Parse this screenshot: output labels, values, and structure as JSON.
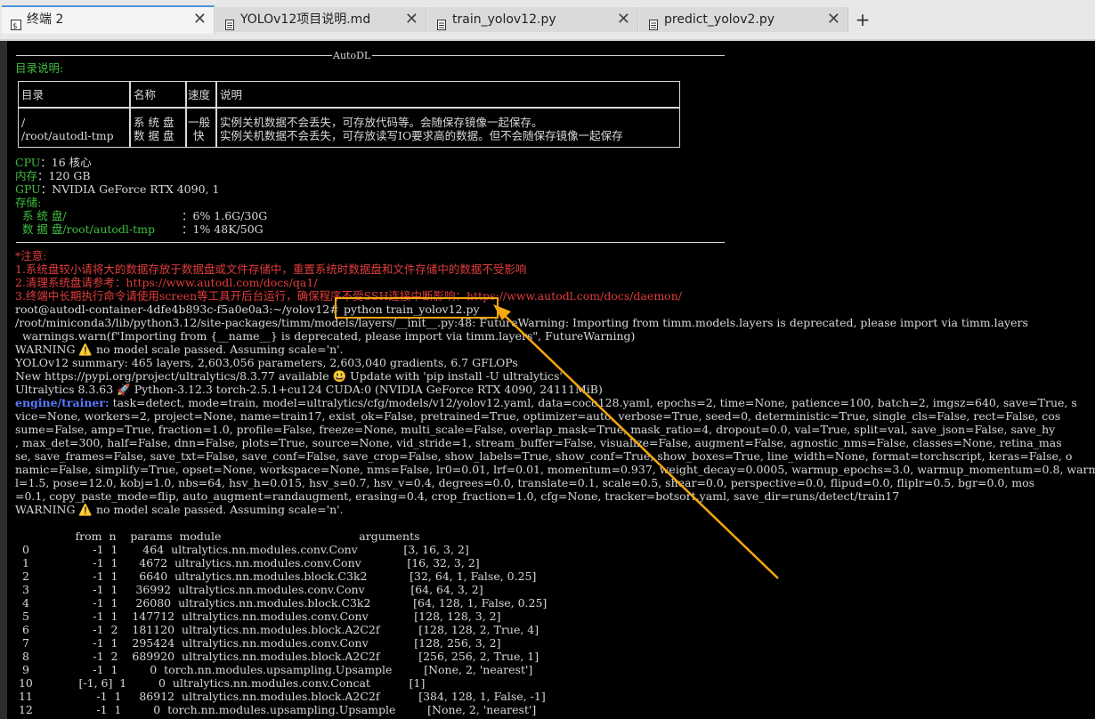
{
  "tabs": [
    {
      "label": "终端 2",
      "icon": "terminal-icon",
      "active": true
    },
    {
      "label": "YOLOv12项目说明.md",
      "icon": "document-icon",
      "active": false
    },
    {
      "label": "train_yolov12.py",
      "icon": "document-icon",
      "active": false
    },
    {
      "label": "predict_yolov2.py",
      "icon": "document-icon",
      "active": false
    }
  ],
  "close_glyph": "✕",
  "new_tab_glyph": "+",
  "terminal": {
    "banner": "AutoDL",
    "dir_title": "目录说明:",
    "table": {
      "headers": [
        "目录",
        "名称",
        "速度",
        "说明"
      ],
      "row": {
        "dirs": [
          "/",
          "/root/autodl-tmp"
        ],
        "names": [
          "系 统 盘",
          "数 据 盘"
        ],
        "speeds": [
          "一般",
          "快"
        ],
        "descs": [
          "实例关机数据不会丢失，可存放代码等。会随保存镜像一起保存。",
          "实例关机数据不会丢失，可存放读写IO要求高的数据。但不会随保存镜像一起保存"
        ]
      }
    },
    "cpu_label": "CPU",
    "cpu_value": "：16 核心",
    "mem_label": "内存",
    "mem_value": "：120 GB",
    "gpu_label": "GPU",
    "gpu_value": "：NVIDIA GeForce RTX 4090, 1",
    "storage_label": "存储:",
    "sys_disk_label": "  系 统 盘/",
    "sys_disk_value": "：6% 1.6G/30G",
    "data_disk_label": "  数 据 盘/root/autodl-tmp",
    "data_disk_value": "：1% 48K/50G",
    "note_title": "*注意:",
    "note1": "1.系统盘较小请将大的数据存放于数据盘或文件存储中，重置系统时数据盘和文件存储中的数据不受影响",
    "note2": "2.清理系统盘请参考：https://www.autodl.com/docs/qa1/",
    "note3": "3.终端中长期执行命令请使用screen等工具开后台运行，确保程序不受SSH连接中断影响：https://www.autodl.com/docs/daemon/",
    "prompt": "root@autodl-container-4dfe4b893c-f5a0e0a3:~/yolov12# ",
    "command": "python train_yolov12.py",
    "log_lines": [
      "/root/miniconda3/lib/python3.12/site-packages/timm/models/layers/__init__.py:48: FutureWarning: Importing from timm.models.layers is deprecated, please import via timm.layers",
      "  warnings.warn(f\"Importing from {__name__} is deprecated, please import via timm.layers\", FutureWarning)",
      "WARNING ⚠️ no model scale passed. Assuming scale='n'.",
      "YOLOv12 summary: 465 layers, 2,603,056 parameters, 2,603,040 gradients, 6.7 GFLOPs",
      "New https://pypi.org/project/ultralytics/8.3.77 available 😃 Update with 'pip install -U ultralytics'",
      "Ultralytics 8.3.63 🚀 Python-3.12.3 torch-2.5.1+cu124 CUDA:0 (NVIDIA GeForce RTX 4090, 24111MiB)"
    ],
    "trainer_label": "engine/trainer:",
    "trainer_lines": [
      " task=detect, mode=train, model=ultralytics/cfg/models/v12/yolov12.yaml, data=coco128.yaml, epochs=2, time=None, patience=100, batch=2, imgsz=640, save=True, s",
      "vice=None, workers=2, project=None, name=train17, exist_ok=False, pretrained=True, optimizer=auto, verbose=True, seed=0, deterministic=True, single_cls=False, rect=False, cos",
      "sume=False, amp=True, fraction=1.0, profile=False, freeze=None, multi_scale=False, overlap_mask=True, mask_ratio=4, dropout=0.0, val=True, split=val, save_json=False, save_hy",
      ", max_det=300, half=False, dnn=False, plots=True, source=None, vid_stride=1, stream_buffer=False, visualize=False, augment=False, agnostic_nms=False, classes=None, retina_mas",
      "se, save_frames=False, save_txt=False, save_conf=False, save_crop=False, show_labels=True, show_conf=True, show_boxes=True, line_width=None, format=torchscript, keras=False, o",
      "namic=False, simplify=True, opset=None, workspace=None, nms=False, lr0=0.01, lrf=0.01, momentum=0.937, weight_decay=0.0005, warmup_epochs=3.0, warmup_momentum=0.8, warmup_bia",
      "l=1.5, pose=12.0, kobj=1.0, nbs=64, hsv_h=0.015, hsv_s=0.7, hsv_v=0.4, degrees=0.0, translate=0.1, scale=0.5, shear=0.0, perspective=0.0, flipud=0.0, fliplr=0.5, bgr=0.0, mos",
      "=0.1, copy_paste_mode=flip, auto_augment=randaugment, erasing=0.4, crop_fraction=1.0, cfg=None, tracker=botsort.yaml, save_dir=runs/detect/train17"
    ],
    "warning2": "WARNING ⚠️ no model scale passed. Assuming scale='n'.",
    "model_table": {
      "header": "                 from  n    params  module                                       arguments",
      "rows": [
        "  0                  -1  1       464  ultralytics.nn.modules.conv.Conv             [3, 16, 3, 2]",
        "  1                  -1  1      4672  ultralytics.nn.modules.conv.Conv             [16, 32, 3, 2]",
        "  2                  -1  1      6640  ultralytics.nn.modules.block.C3k2            [32, 64, 1, False, 0.25]",
        "  3                  -1  1     36992  ultralytics.nn.modules.conv.Conv             [64, 64, 3, 2]",
        "  4                  -1  1     26080  ultralytics.nn.modules.block.C3k2            [64, 128, 1, False, 0.25]",
        "  5                  -1  1    147712  ultralytics.nn.modules.conv.Conv             [128, 128, 3, 2]",
        "  6                  -1  2    181120  ultralytics.nn.modules.block.A2C2f           [128, 128, 2, True, 4]",
        "  7                  -1  1    295424  ultralytics.nn.modules.conv.Conv             [128, 256, 3, 2]",
        "  8                  -1  2    689920  ultralytics.nn.modules.block.A2C2f           [256, 256, 2, True, 1]",
        "  9                  -1  1         0  torch.nn.modules.upsampling.Upsample         [None, 2, 'nearest']",
        " 10             [-1, 6]  1         0  ultralytics.nn.modules.conv.Concat           [1]",
        " 11                  -1  1     86912  ultralytics.nn.modules.block.A2C2f           [384, 128, 1, False, -1]",
        " 12                  -1  1         0  torch.nn.modules.upsampling.Upsample         [None, 2, 'nearest']"
      ]
    }
  },
  "colors": {
    "terminal_bg": "#000000",
    "green": "#3fbe3f",
    "red": "#e23c3c",
    "highlight": "#f5a70e",
    "trainer_blue": "#5b7cff"
  }
}
